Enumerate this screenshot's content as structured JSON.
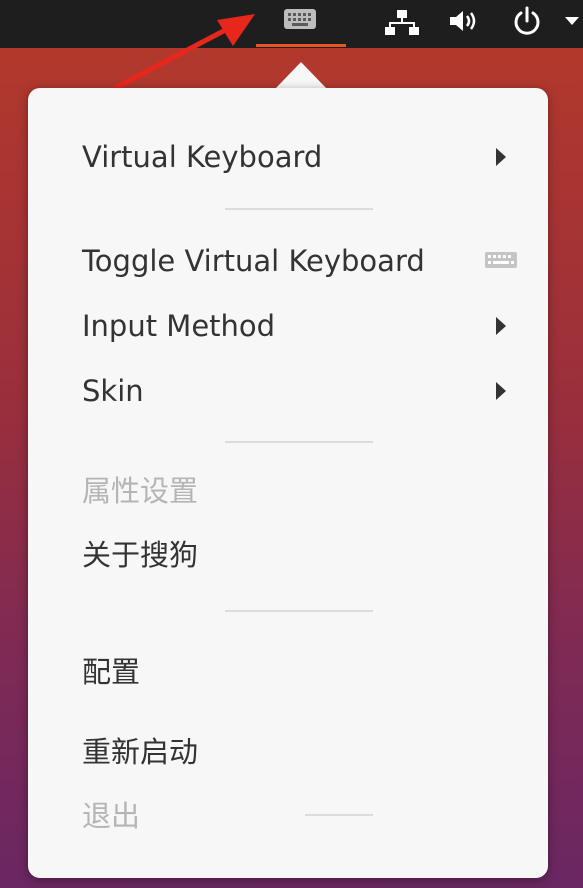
{
  "topbar": {
    "tray_icons": [
      "keyboard-icon",
      "network-icon",
      "volume-icon",
      "power-icon",
      "chevron-down-icon"
    ],
    "active_indicator_color": "#e95420"
  },
  "annotation": {
    "arrow_color": "#e8271c"
  },
  "menu": {
    "items": [
      {
        "label": "Virtual Keyboard",
        "submenu": true
      },
      {
        "label": "Toggle Virtual Keyboard",
        "icon": "keyboard-icon"
      },
      {
        "label": "Input Method",
        "submenu": true
      },
      {
        "label": "Skin",
        "submenu": true
      },
      {
        "label": "属性设置",
        "disabled": true
      },
      {
        "label": "关于搜狗"
      },
      {
        "label": "配置"
      },
      {
        "label": "重新启动"
      },
      {
        "label": "退出",
        "disabled": true
      }
    ]
  },
  "colors": {
    "menu_bg": "#f7f7f7",
    "text": "#333333",
    "disabled_text": "#b5b5b5",
    "desktop_gradient": [
      "#b53a2a",
      "#6a2763"
    ]
  }
}
